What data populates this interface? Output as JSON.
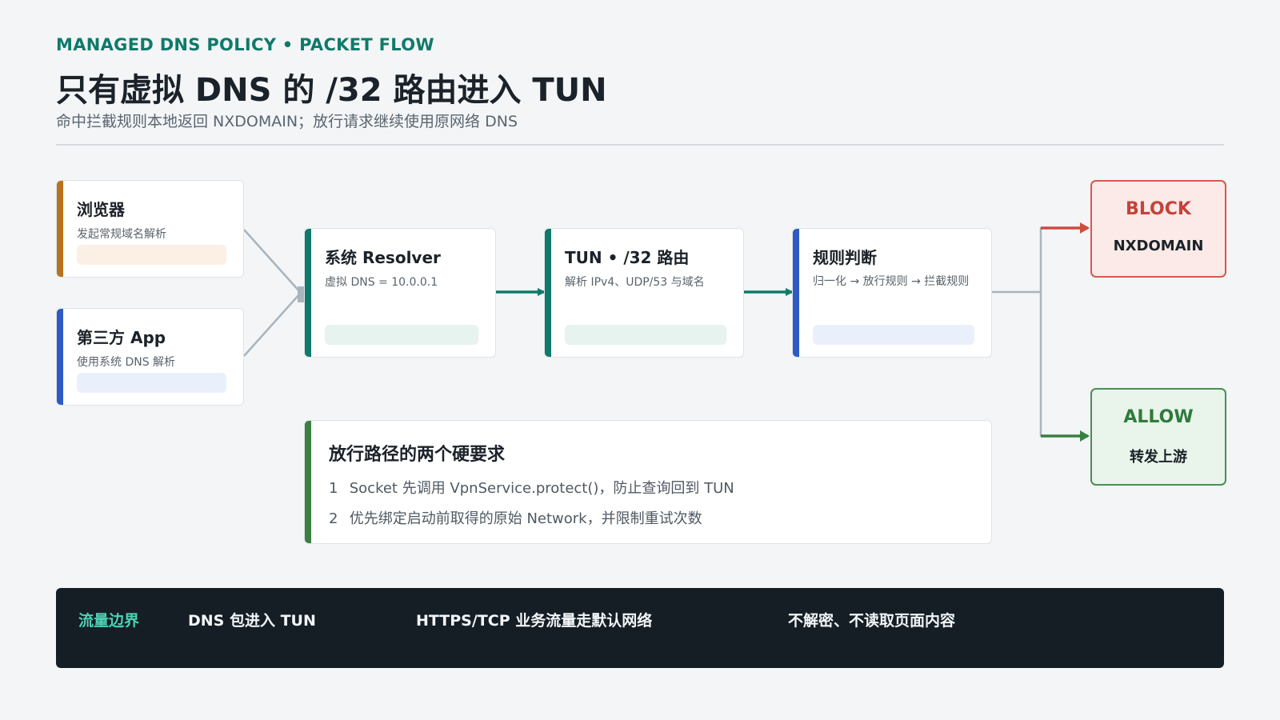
{
  "header": {
    "eyebrow": "MANAGED DNS POLICY • PACKET FLOW",
    "title": "只有虚拟 DNS 的 /32 路由进入 TUN",
    "subtitle": "命中拦截规则本地返回 NXDOMAIN；放行请求继续使用原网络 DNS"
  },
  "sources": {
    "browser": {
      "title": "浏览器",
      "desc": "发起常规域名解析",
      "accent": "#b8721c",
      "pill": "#fbf0e3"
    },
    "app": {
      "title": "第三方 App",
      "desc": "使用系统 DNS 解析",
      "accent": "#2d5bc2",
      "pill": "#eaf0fb"
    }
  },
  "stages": [
    {
      "title": "系统 Resolver",
      "desc": "虚拟 DNS = 10.0.0.1",
      "accent": "#0f7a6a",
      "pill": "#e6f3ef"
    },
    {
      "title": "TUN • /32 路由",
      "desc": "解析 IPv4、UDP/53 与域名",
      "accent": "#0f7a6a",
      "pill": "#e6f3ef"
    },
    {
      "title": "规则判断",
      "desc": "归一化 → 放行规则 → 拦截规则",
      "accent": "#2d5bc2",
      "pill": "#eaf0fb"
    }
  ],
  "outcomes": {
    "block": {
      "label": "BLOCK",
      "detail": "NXDOMAIN",
      "color": "#c4433a",
      "bg": "#fbeae7",
      "border": "#d9574d"
    },
    "allow": {
      "label": "ALLOW",
      "detail": "转发上游",
      "color": "#2f7a3c",
      "bg": "#e9f4ea",
      "border": "#4a8f55"
    }
  },
  "requirements": {
    "title": "放行路径的两个硬要求",
    "accent": "#3a8041",
    "items": [
      {
        "num": "1",
        "text": "Socket 先调用 VpnService.protect()，防止查询回到 TUN"
      },
      {
        "num": "2",
        "text": "优先绑定启动前取得的原始 Network，并限制重试次数"
      }
    ]
  },
  "footer": {
    "label": "流量边界",
    "label_color": "#4fd1b5",
    "item1": "DNS 包进入 TUN",
    "item2": "HTTPS/TCP 业务流量走默认网络",
    "item3": "不解密、不读取页面内容"
  },
  "colors": {
    "teal_arrow": "#0f7a6a",
    "gray_line": "#a9b4bd",
    "block_arrow": "#d04a3f",
    "allow_arrow": "#3a8041"
  }
}
